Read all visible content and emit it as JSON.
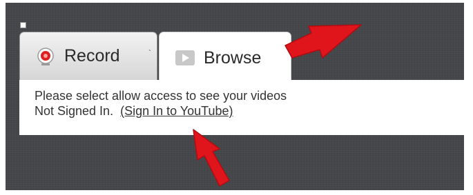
{
  "tabs": [
    {
      "label": "Record",
      "icon": "record-icon",
      "selected": false
    },
    {
      "label": "Browse",
      "icon": "play-icon",
      "selected": true
    }
  ],
  "panel": {
    "message": "Please select allow access to see your videos",
    "status": "Not Signed In.",
    "sign_in_link": "(Sign In to YouTube)"
  },
  "annotations": {
    "arrow_color": "#e0141b"
  },
  "colors": {
    "background": "#46474a",
    "record_red": "#e02020"
  }
}
